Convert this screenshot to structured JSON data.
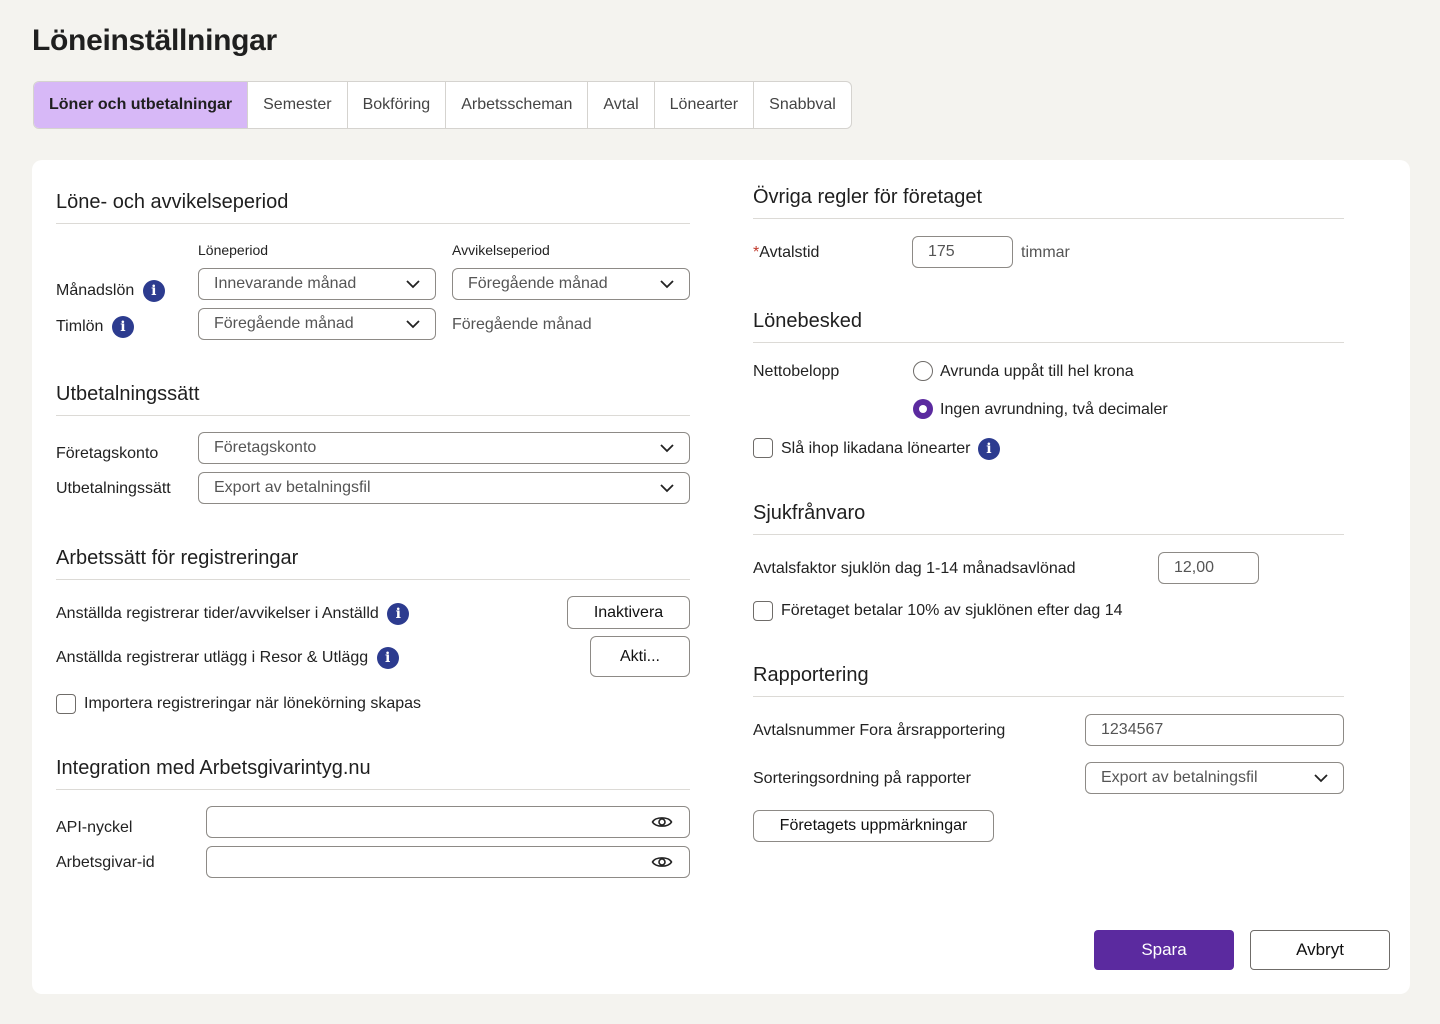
{
  "page": {
    "title": "Löneinställningar"
  },
  "tabs": [
    {
      "label": "Löner och utbetalningar",
      "active": true
    },
    {
      "label": "Semester"
    },
    {
      "label": "Bokföring"
    },
    {
      "label": "Arbetsscheman"
    },
    {
      "label": "Avtal"
    },
    {
      "label": "Lönearter"
    },
    {
      "label": "Snabbval"
    }
  ],
  "period": {
    "heading": "Löne- och avvikelseperiod",
    "col_loneperiod": "Löneperiod",
    "col_avvikelseperiod": "Avvikelseperiod",
    "manadslon": {
      "label": "Månadslön",
      "loneperiod": "Innevarande månad",
      "avvikelseperiod": "Föregående månad"
    },
    "timlon": {
      "label": "Timlön",
      "loneperiod": "Föregående månad",
      "avvikelseperiod": "Föregående månad"
    }
  },
  "payout": {
    "heading": "Utbetalningssätt",
    "company_account_label": "Företagskonto",
    "company_account_value": "Företagskonto",
    "method_label": "Utbetalningssätt",
    "method_value": "Export av betalningsfil"
  },
  "registrations": {
    "heading": "Arbetssätt för registreringar",
    "row1_label": "Anställda registrerar tider/avvikelser i Anställd",
    "row1_button": "Inaktivera",
    "row2_label": "Anställda registrerar utlägg i Resor & Utlägg",
    "row2_button": "Akti...",
    "import_label": "Importera registreringar när lönekörning skapas",
    "import_checked": false
  },
  "integration": {
    "heading": "Integration med Arbetsgivarintyg.nu",
    "api_label": "API-nyckel",
    "api_value": "",
    "employer_label": "Arbetsgivar-id",
    "employer_value": ""
  },
  "other_rules": {
    "heading": "Övriga regler för företaget",
    "required_mark": "*",
    "hours_label": "Avtalstid",
    "hours_value": "175",
    "hours_unit": "timmar"
  },
  "payslip": {
    "heading": "Lönebesked",
    "net_label": "Nettobelopp",
    "option1": "Avrunda uppåt till hel krona",
    "option2": "Ingen avrundning, två decimaler",
    "selected_option": 2,
    "merge_label": "Slå ihop likadana lönearter",
    "merge_checked": false
  },
  "sick": {
    "heading": "Sjukfrånvaro",
    "factor_label": "Avtalsfaktor sjuklön dag 1-14 månadsavlönad",
    "factor_value": "12,00",
    "pays_label": "Företaget betalar 10% av sjuklönen efter dag 14",
    "pays_checked": false
  },
  "reporting": {
    "heading": "Rapportering",
    "fora_label": "Avtalsnummer Fora årsrapportering",
    "fora_value": "1234567",
    "sort_label": "Sorteringsordning på rapporter",
    "sort_value": "Export av betalningsfil",
    "marks_button": "Företagets uppmärkningar"
  },
  "footer": {
    "save": "Spara",
    "cancel": "Avbryt"
  },
  "colors": {
    "accent": "#5b2a9f",
    "tab_active": "#d7b8f7",
    "info": "#2c3b8f",
    "background": "#f4f3ef"
  }
}
